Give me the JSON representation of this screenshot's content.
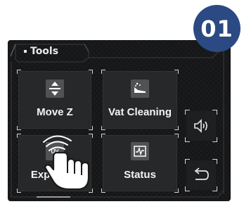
{
  "badge": {
    "number": "01",
    "color": "#2b4a83"
  },
  "tab": {
    "label": "Tools"
  },
  "tiles": [
    {
      "label": "Move Z",
      "icon": "move-z-icon"
    },
    {
      "label": "Vat Cleaning",
      "icon": "vat-cleaning-icon"
    },
    {
      "label": "Exposure",
      "icon": "exposure-icon"
    },
    {
      "label": "Status",
      "icon": "status-icon"
    }
  ],
  "side_buttons": [
    {
      "icon": "speaker-icon"
    },
    {
      "icon": "back-arrow-icon"
    }
  ],
  "overlay": {
    "icon": "tap-hand-icon"
  }
}
